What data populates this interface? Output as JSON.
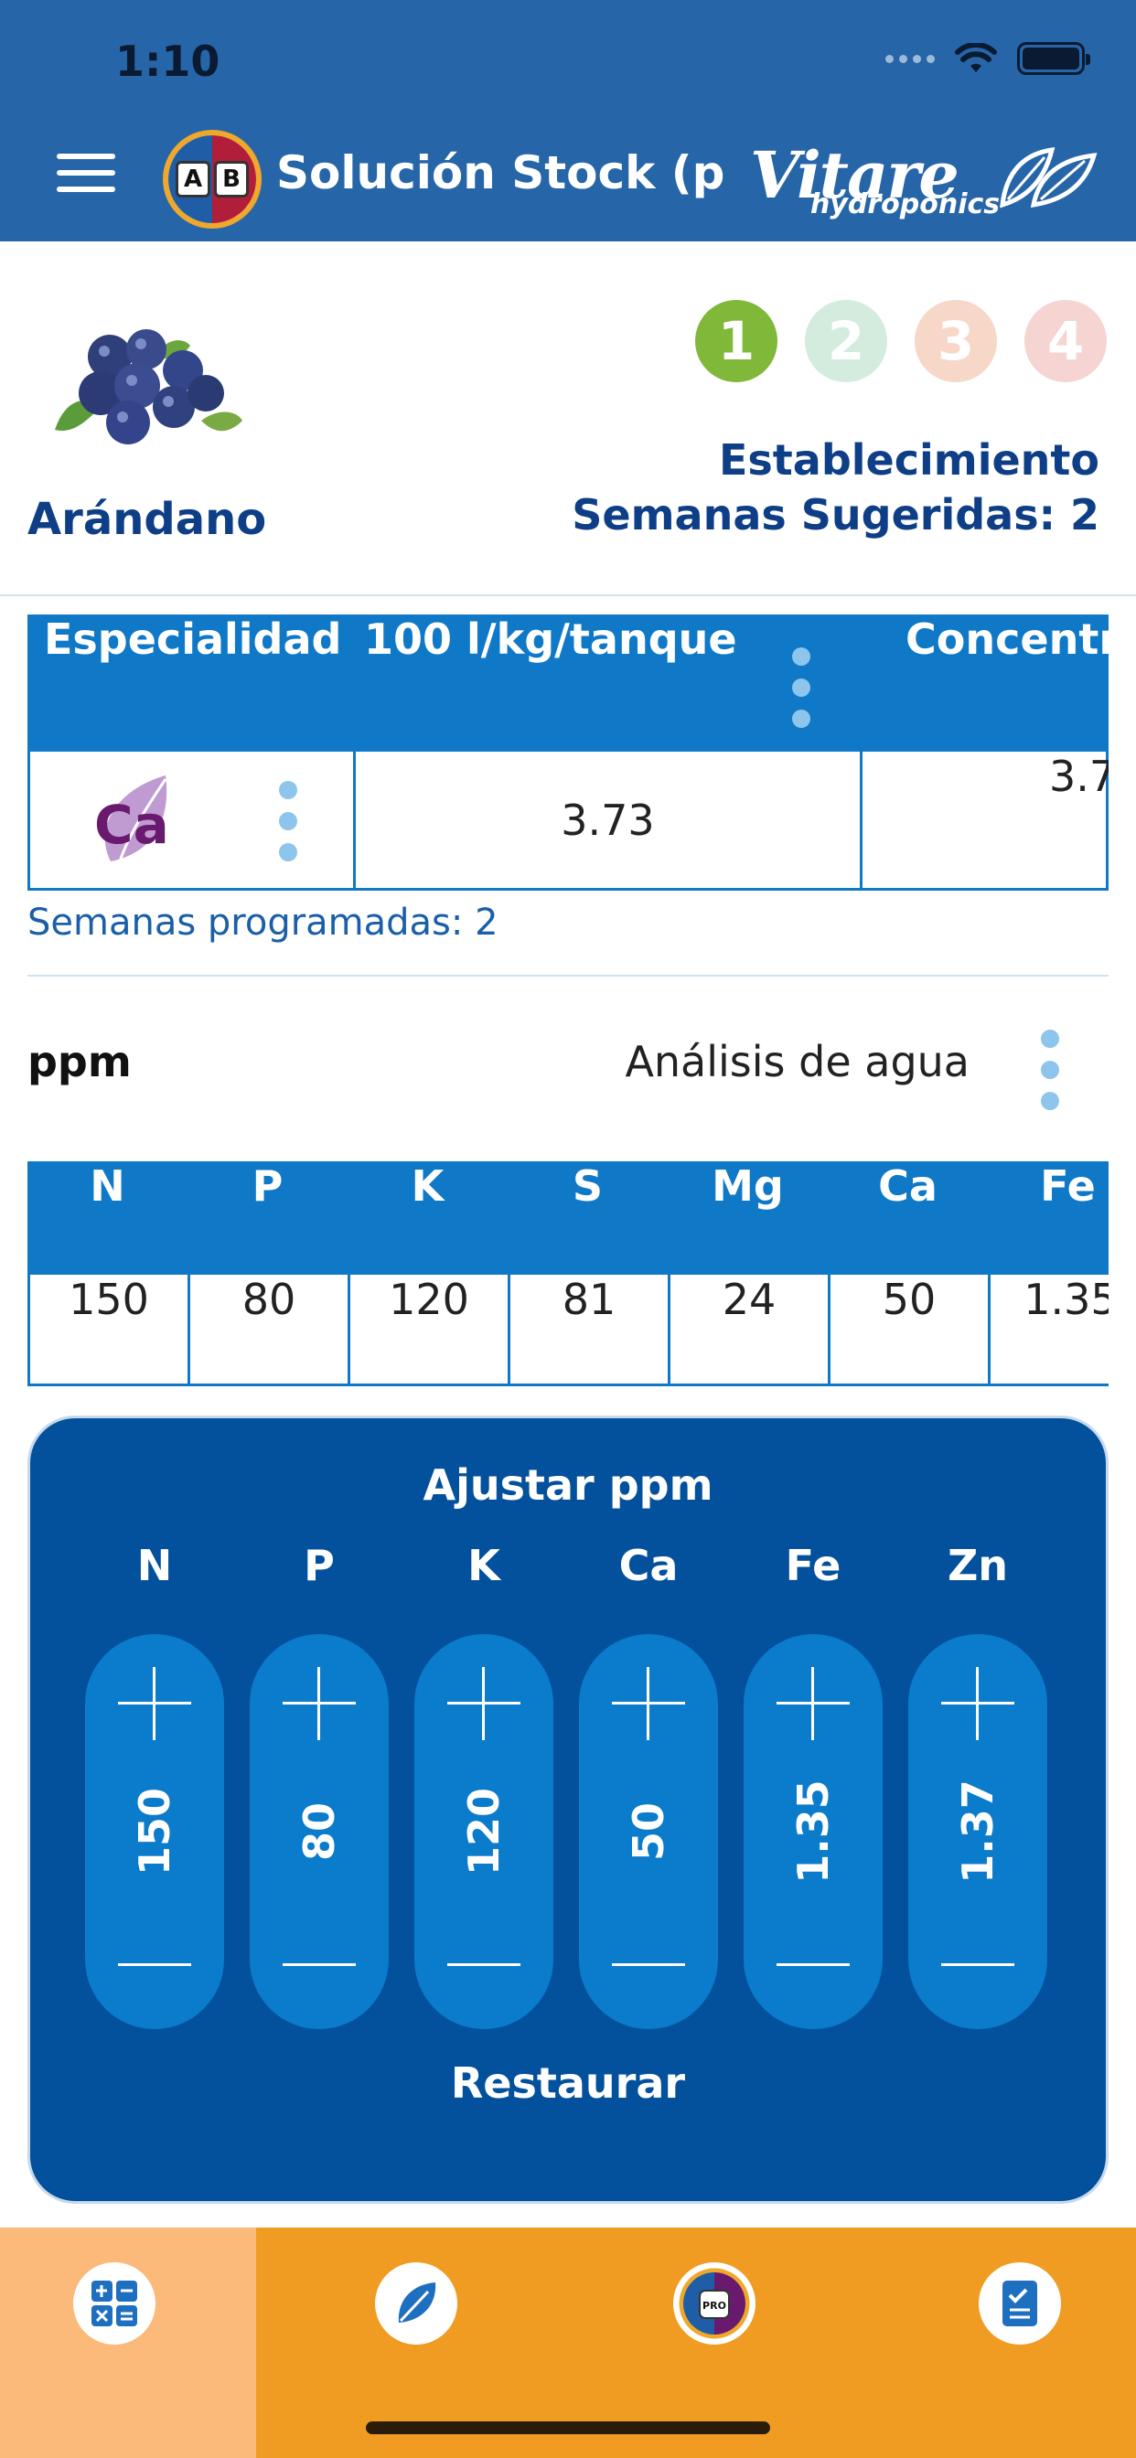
{
  "status_bar": {
    "time": "1:10"
  },
  "header": {
    "title": "Solución Stock (pr...",
    "logo_letters": [
      "A",
      "B"
    ],
    "brand_name": "Vitare",
    "brand_sub": "hydroponics"
  },
  "crop": {
    "name": "Arándano",
    "image_icon": "blueberries-image"
  },
  "steps": [
    {
      "label": "1",
      "color": "#80b83a",
      "active": true
    },
    {
      "label": "2",
      "color": "#d3ecde",
      "active": false
    },
    {
      "label": "3",
      "color": "#f7d7c8",
      "active": false
    },
    {
      "label": "4",
      "color": "#f5d4d2",
      "active": false
    }
  ],
  "stage": {
    "name": "Establecimiento",
    "weeks_suggested": "Semanas Sugeridas: 2"
  },
  "product_table": {
    "headers": [
      "Especialidad",
      "100 l/kg/tanque",
      "Concentr"
    ],
    "rows": [
      {
        "icon": "ca-leaf-icon",
        "icon_text": "Ca",
        "dose": "3.73",
        "concentration": "3.7"
      }
    ],
    "weeks_programmed": "Semanas programadas: 2"
  },
  "ppm_section": {
    "label": "ppm",
    "water_analysis": "Análisis de agua"
  },
  "nutrients": {
    "headers": [
      "N",
      "P",
      "K",
      "S",
      "Mg",
      "Ca",
      "Fe"
    ],
    "values": [
      "150",
      "80",
      "120",
      "81",
      "24",
      "50",
      "1.35"
    ]
  },
  "adjust": {
    "title": "Ajustar ppm",
    "items": [
      {
        "element": "N",
        "value": "150"
      },
      {
        "element": "P",
        "value": "80"
      },
      {
        "element": "K",
        "value": "120"
      },
      {
        "element": "Ca",
        "value": "50"
      },
      {
        "element": "Fe",
        "value": "1.35"
      },
      {
        "element": "Zn",
        "value": "1.37"
      }
    ],
    "restore_label": "Restaurar"
  },
  "tabbar": {
    "tabs": [
      {
        "icon": "calculator-icon",
        "active": true
      },
      {
        "icon": "leaf-icon",
        "active": false
      },
      {
        "icon": "product-icon",
        "active": false
      },
      {
        "icon": "checklist-icon",
        "active": false
      }
    ]
  },
  "colors": {
    "header_bg": "#2666a8",
    "table_blue": "#0f79c8",
    "panel_blue": "#03519c",
    "tabbar_orange": "#f09c22",
    "tab_active": "#fbb97a",
    "dots_light_blue": "#8ec5ec"
  }
}
